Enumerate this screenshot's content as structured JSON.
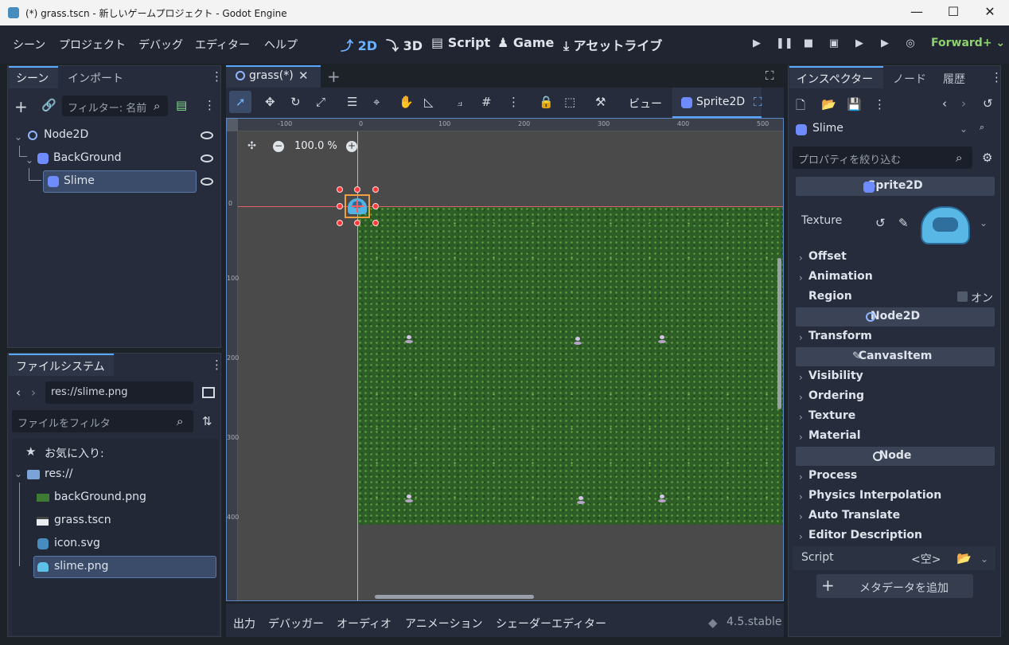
{
  "window": {
    "title": "(*) grass.tscn - 新しいゲームプロジェクト - Godot Engine"
  },
  "menu": {
    "items": [
      "シーン",
      "プロジェクト",
      "デバッグ",
      "エディター",
      "ヘルプ"
    ]
  },
  "workspaces": {
    "2d": "2D",
    "3d": "3D",
    "script": "Script",
    "game": "Game",
    "assetlib": "アセットライブ"
  },
  "renderer": "Forward+",
  "scene_dock": {
    "tabs": [
      "シーン",
      "インポート"
    ],
    "filter_placeholder": "フィルター: 名前",
    "nodes": [
      {
        "name": "Node2D"
      },
      {
        "name": "BackGround"
      },
      {
        "name": "Slime"
      }
    ]
  },
  "filesystem": {
    "tab": "ファイルシステム",
    "path": "res://slime.png",
    "filter_placeholder": "ファイルをフィルタ",
    "favorites": "お気に入り:",
    "root": "res://",
    "files": [
      "backGround.png",
      "grass.tscn",
      "icon.svg",
      "slime.png"
    ]
  },
  "editor": {
    "tab": "grass(*)",
    "view_menu": "ビュー",
    "selected_node": "Sprite2D",
    "zoom": "100.0 %",
    "ruler_h": [
      "-100",
      "0",
      "100",
      "200",
      "300",
      "400",
      "500"
    ],
    "ruler_v": [
      "0",
      "100",
      "200",
      "300",
      "400"
    ]
  },
  "inspector": {
    "tabs": [
      "インスペクター",
      "ノード",
      "履歴"
    ],
    "object": "Slime",
    "filter_placeholder": "プロパティを絞り込む",
    "sections": {
      "sprite2d": "Sprite2D",
      "node2d": "Node2D",
      "canvasitem": "CanvasItem",
      "node": "Node"
    },
    "texture_label": "Texture",
    "sprite_props": [
      "Offset",
      "Animation"
    ],
    "region_label": "Region",
    "region_value": "オン",
    "node2d_props": [
      "Transform"
    ],
    "canvasitem_props": [
      "Visibility",
      "Ordering",
      "Texture",
      "Material"
    ],
    "node_props": [
      "Process",
      "Physics Interpolation",
      "Auto Translate",
      "Editor Description"
    ],
    "script_label": "Script",
    "script_value": "<空>",
    "add_metadata": "メタデータを追加"
  },
  "bottom": {
    "tabs": [
      "出力",
      "デバッガー",
      "オーディオ",
      "アニメーション",
      "シェーダーエディター"
    ],
    "version": "4.5.stable"
  }
}
